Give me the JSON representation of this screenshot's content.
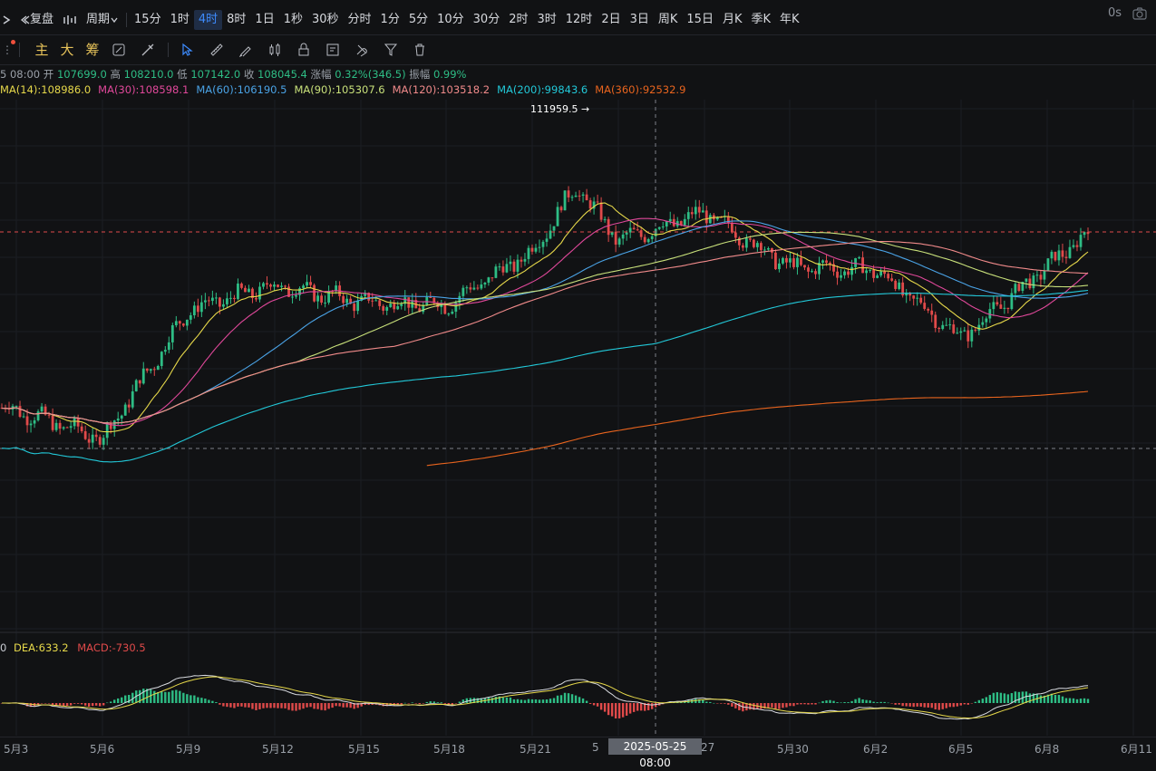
{
  "toolbar": {
    "adjust_label": "复盘",
    "period_label": "周期",
    "periods": [
      "15分",
      "1时",
      "4时",
      "8时",
      "1日",
      "1秒",
      "30秒",
      "分时",
      "1分",
      "5分",
      "10分",
      "30分",
      "2时",
      "3时",
      "12时",
      "2日",
      "3日",
      "周K",
      "15日",
      "月K",
      "季K",
      "年K"
    ],
    "active_period": "4时",
    "latency": "0s"
  },
  "drawing_toolbar": {
    "indicator_main": "主",
    "indicator_big": "大",
    "indicator_chips": "筹"
  },
  "ohlc": {
    "time": "5 08:00",
    "open_label": "开",
    "open": "107699.0",
    "high_label": "高",
    "high": "108210.0",
    "low_label": "低",
    "low": "107142.0",
    "close_label": "收",
    "close": "108045.4",
    "change_label": "涨幅",
    "change": "0.32%(346.5)",
    "amplitude_label": "振幅",
    "amplitude": "0.99%"
  },
  "ma_legend": [
    {
      "text": "MA(14):108986.0",
      "color": "#e6d84a"
    },
    {
      "text": "MA(30):108598.1",
      "color": "#e0489a"
    },
    {
      "text": "MA(60):106190.5",
      "color": "#4aa3e6"
    },
    {
      "text": "MA(90):105307.6",
      "color": "#c8e07a"
    },
    {
      "text": "MA(120):103518.2",
      "color": "#f08a8a"
    },
    {
      "text": "MA(200):99843.6",
      "color": "#22c8d8"
    },
    {
      "text": "MA(360):92532.9",
      "color": "#e8641e"
    }
  ],
  "high_marker": "111959.5",
  "macd_legend": {
    "prefix": "0",
    "dea": "DEA:633.2",
    "macd": "MACD:-730.5"
  },
  "x_axis": [
    "5月3",
    "5月6",
    "5月9",
    "5月12",
    "5月15",
    "5月18",
    "5月21",
    "5",
    "27",
    "5月30",
    "6月2",
    "6月5",
    "6月8",
    "6月11"
  ],
  "crosshair_time": "2025-05-25 08:00",
  "colors": {
    "up": "#2ebd85",
    "down": "#e04a4a",
    "accent": "#3d8bfd",
    "background": "#111214"
  },
  "chart_data": {
    "type": "candlestick",
    "x": [
      "5月3",
      "5月6",
      "5月9",
      "5月12",
      "5月15",
      "5月18",
      "5月21",
      "2025-05-25 08:00",
      "27",
      "5月30",
      "6月2",
      "6月5",
      "6月8",
      "6月11"
    ],
    "close_anchors": [
      {
        "x": "5月3",
        "close": 96500
      },
      {
        "x": "5月6",
        "close": 94600
      },
      {
        "x": "5月9",
        "close": 103000
      },
      {
        "x": "5月12",
        "close": 104600
      },
      {
        "x": "5月15",
        "close": 103500
      },
      {
        "x": "5月18",
        "close": 103300
      },
      {
        "x": "5月21",
        "close": 106800
      },
      {
        "x": "5月22",
        "close": 111000
      },
      {
        "x": "5月25",
        "close": 107500
      },
      {
        "x": "27",
        "close": 109300
      },
      {
        "x": "5月30",
        "close": 105800
      },
      {
        "x": "6月2",
        "close": 105600
      },
      {
        "x": "6月5",
        "close": 101200
      },
      {
        "x": "6月8",
        "close": 105800
      },
      {
        "x": "6月9",
        "close": 108045.4
      }
    ],
    "max_high": 111959.5,
    "moving_averages": [
      "MA(14)",
      "MA(30)",
      "MA(60)",
      "MA(90)",
      "MA(120)",
      "MA(200)",
      "MA(360)"
    ],
    "sub_indicator": "MACD"
  }
}
